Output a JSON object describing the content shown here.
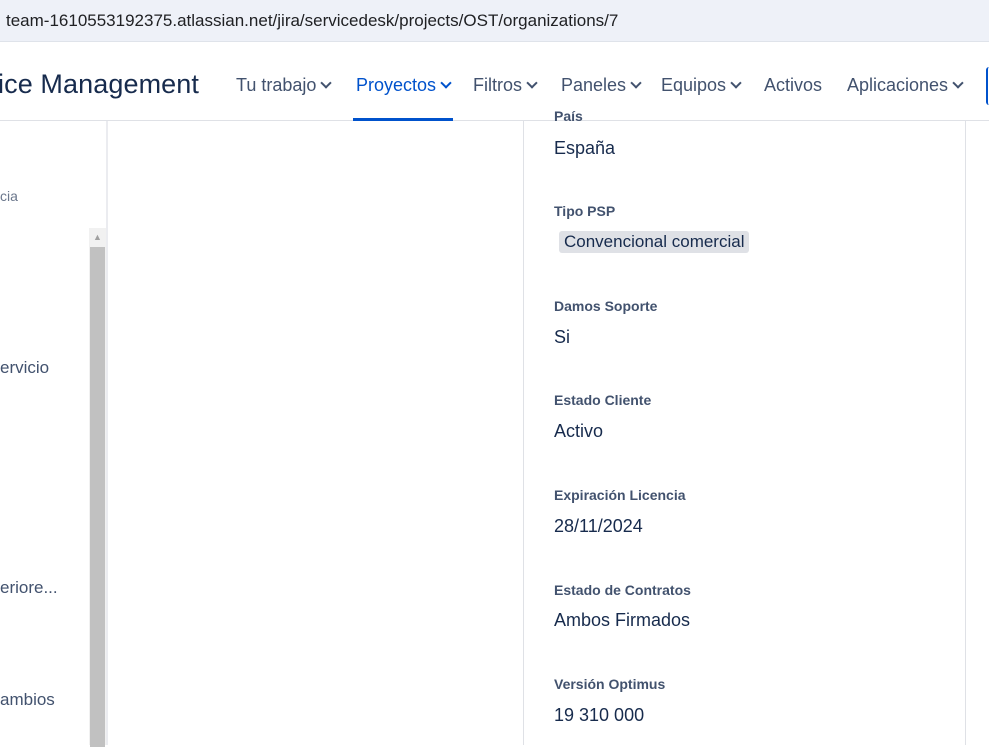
{
  "browser": {
    "url": "team-1610553192375.atlassian.net/jira/servicedesk/projects/OST/organizations/7"
  },
  "topnav": {
    "brand": "ice Management",
    "items": [
      {
        "label": "Tu trabajo",
        "dropdown": true
      },
      {
        "label": "Proyectos",
        "dropdown": true,
        "active": true
      },
      {
        "label": "Filtros",
        "dropdown": true
      },
      {
        "label": "Paneles",
        "dropdown": true
      },
      {
        "label": "Equipos",
        "dropdown": true
      },
      {
        "label": "Activos",
        "dropdown": false
      },
      {
        "label": "Aplicaciones",
        "dropdown": true
      }
    ],
    "accent_color": "#0052cc"
  },
  "sidebar": {
    "items": [
      {
        "label": "cia"
      },
      {
        "label": "ervicio"
      },
      {
        "label": "eriore..."
      },
      {
        "label": "ambios"
      }
    ]
  },
  "details": {
    "fields": [
      {
        "label": "País",
        "value": "España"
      },
      {
        "label": "Tipo PSP",
        "value": "Convencional comercial",
        "lozenge": true
      },
      {
        "label": "Damos Soporte",
        "value": "Si"
      },
      {
        "label": "Estado Cliente",
        "value": "Activo"
      },
      {
        "label": "Expiración Licencia",
        "value": "28/11/2024"
      },
      {
        "label": "Estado de Contratos",
        "value": "Ambos Firmados"
      },
      {
        "label": "Versión Optimus",
        "value": "19 310 000"
      }
    ]
  }
}
